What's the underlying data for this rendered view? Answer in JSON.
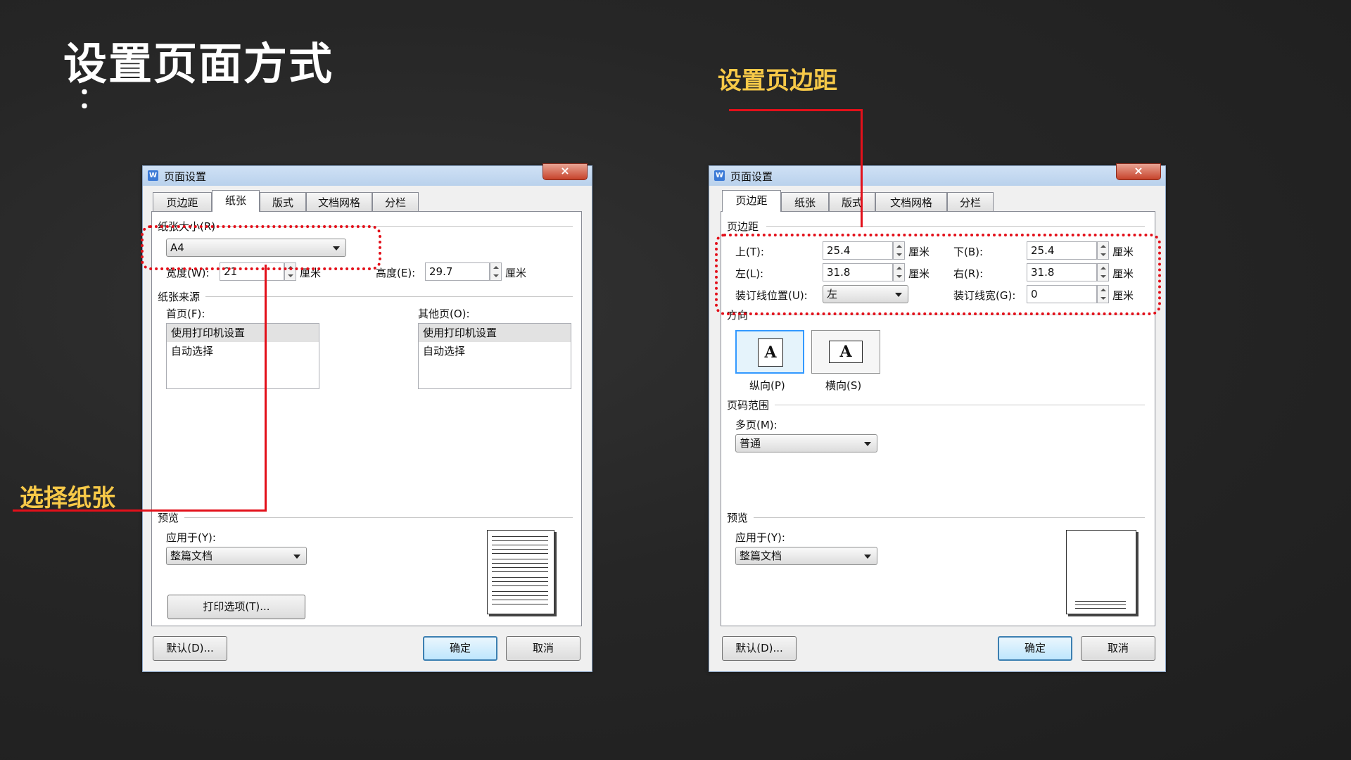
{
  "slide": {
    "title": "设置页面方式",
    "bullet": "：",
    "callout_left": "选择纸张",
    "callout_right": "设置页边距"
  },
  "colors": {
    "background": "#262626",
    "accent_red": "#e3101a",
    "callout_yellow": "#f7c948"
  },
  "dialog_left": {
    "title": "页面设置",
    "close_label": "×",
    "tabs": [
      "页边距",
      "纸张",
      "版式",
      "文档网格",
      "分栏"
    ],
    "active_tab": "纸张",
    "paper_size_label": "纸张大小(R)",
    "paper_size_value": "A4",
    "width_label": "宽度(W):",
    "width_value": "21",
    "height_label": "高度(E):",
    "height_value": "29.7",
    "unit": "厘米",
    "paper_source_label": "纸张来源",
    "first_page_label": "首页(F):",
    "other_pages_label": "其他页(O):",
    "source_items": [
      "使用打印机设置",
      "自动选择"
    ],
    "preview_label": "预览",
    "apply_to_label": "应用于(Y):",
    "apply_to_value": "整篇文档",
    "print_options_label": "打印选项(T)...",
    "default_button": "默认(D)...",
    "ok_button": "确定",
    "cancel_button": "取消"
  },
  "dialog_right": {
    "title": "页面设置",
    "close_label": "×",
    "tabs": [
      "页边距",
      "纸张",
      "版式",
      "文档网格",
      "分栏"
    ],
    "active_tab": "页边距",
    "margins_label": "页边距",
    "top_label": "上(T):",
    "top_value": "25.4",
    "bottom_label": "下(B):",
    "bottom_value": "25.4",
    "left_label": "左(L):",
    "left_value": "31.8",
    "right_label": "右(R):",
    "right_value": "31.8",
    "gutter_pos_label": "装订线位置(U):",
    "gutter_pos_value": "左",
    "gutter_width_label": "装订线宽(G):",
    "gutter_width_value": "0",
    "unit": "厘米",
    "orientation_label": "方向",
    "portrait_label": "纵向(P)",
    "landscape_label": "横向(S)",
    "orientation_icon_glyph": "A",
    "page_range_label": "页码范围",
    "multiple_pages_label": "多页(M):",
    "multiple_pages_value": "普通",
    "preview_label": "预览",
    "apply_to_label": "应用于(Y):",
    "apply_to_value": "整篇文档",
    "default_button": "默认(D)...",
    "ok_button": "确定",
    "cancel_button": "取消"
  }
}
